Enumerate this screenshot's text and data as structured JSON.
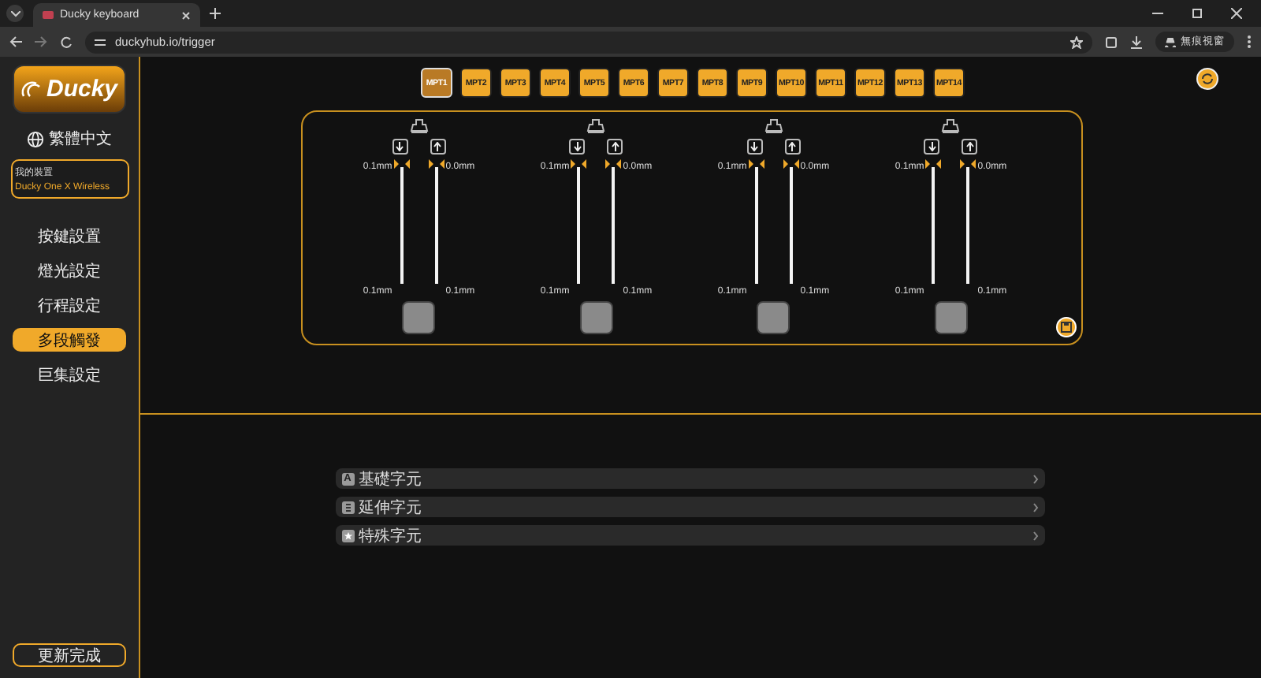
{
  "browser": {
    "tab_title": "Ducky keyboard",
    "url": "duckyhub.io/trigger",
    "profile": "無痕視窗"
  },
  "sidebar": {
    "logo": "Ducky",
    "language": "繁體中文",
    "device": {
      "label": "我的裝置",
      "name": "Ducky One X Wireless"
    },
    "nav": [
      {
        "label": "按鍵設置",
        "selected": false
      },
      {
        "label": "燈光設定",
        "selected": false
      },
      {
        "label": "行程設定",
        "selected": false
      },
      {
        "label": "多段觸發",
        "selected": true
      },
      {
        "label": "巨集設定",
        "selected": false
      }
    ],
    "update_button": "更新完成"
  },
  "mpt_tabs": [
    {
      "label": "MPT1",
      "selected": true
    },
    {
      "label": "MPT2",
      "selected": false
    },
    {
      "label": "MPT3",
      "selected": false
    },
    {
      "label": "MPT4",
      "selected": false
    },
    {
      "label": "MPT5",
      "selected": false
    },
    {
      "label": "MPT6",
      "selected": false
    },
    {
      "label": "MPT7",
      "selected": false
    },
    {
      "label": "MPT8",
      "selected": false
    },
    {
      "label": "MPT9",
      "selected": false
    },
    {
      "label": "MPT10",
      "selected": false
    },
    {
      "label": "MPT11",
      "selected": false
    },
    {
      "label": "MPT12",
      "selected": false
    },
    {
      "label": "MPT13",
      "selected": false
    },
    {
      "label": "MPT14",
      "selected": false
    }
  ],
  "keys": [
    {
      "sliders": [
        {
          "top": "0.1mm",
          "bottom": "0.1mm",
          "level": 1
        },
        {
          "top": "0.0mm",
          "bottom": "0.1mm",
          "level": 1
        }
      ]
    },
    {
      "sliders": [
        {
          "top": "0.1mm",
          "bottom": "0.1mm",
          "level": 1
        },
        {
          "top": "0.0mm",
          "bottom": "0.1mm",
          "level": 1
        }
      ]
    },
    {
      "sliders": [
        {
          "top": "0.1mm",
          "bottom": "0.1mm",
          "level": 1
        },
        {
          "top": "0.0mm",
          "bottom": "0.1mm",
          "level": 1
        }
      ]
    },
    {
      "sliders": [
        {
          "top": "0.1mm",
          "bottom": "0.1mm",
          "level": 1
        },
        {
          "top": "0.0mm",
          "bottom": "0.1mm",
          "level": 1
        }
      ]
    }
  ],
  "categories": [
    {
      "kind": "letter",
      "badge": "A",
      "label": "基礎字元"
    },
    {
      "kind": "page",
      "label": "延伸字元"
    },
    {
      "kind": "star",
      "label": "特殊字元"
    }
  ]
}
